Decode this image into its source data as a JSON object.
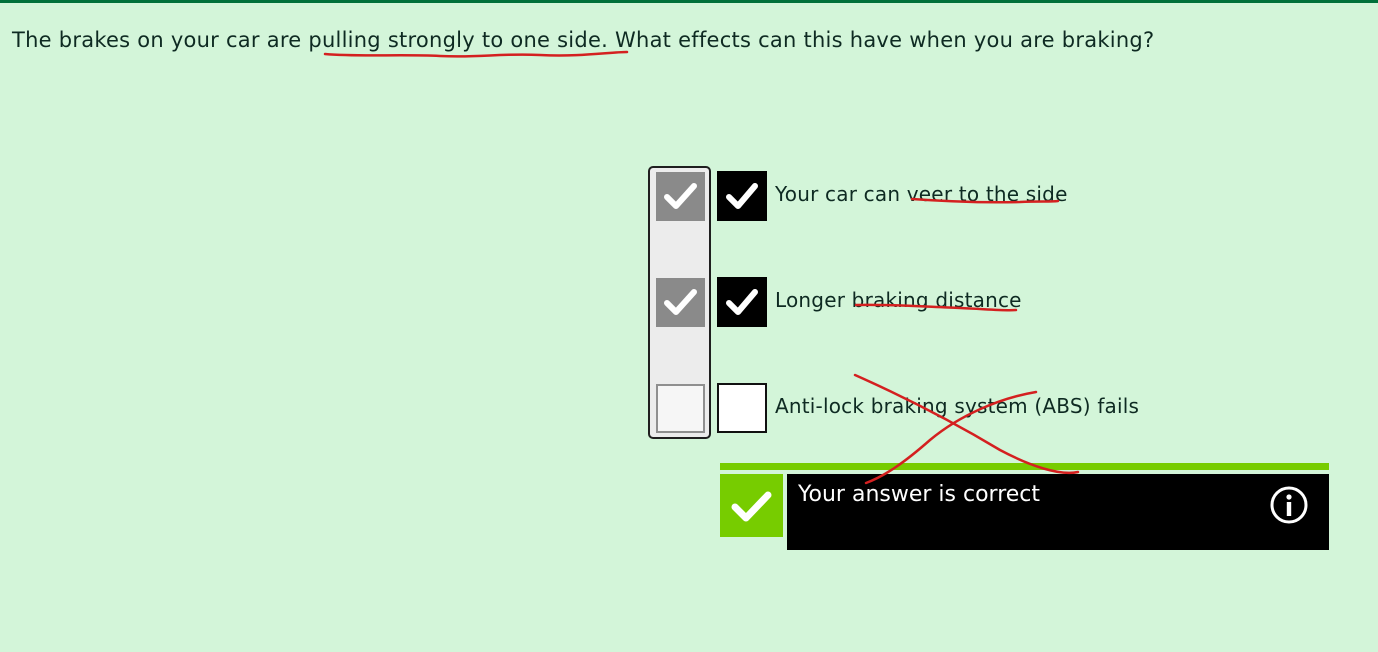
{
  "question": {
    "before": "The brakes on your car are ",
    "highlight": "pulling strongly to one side",
    "after": ". What effects can this have when you are braking?"
  },
  "options": [
    {
      "label": "Your car can veer to the side",
      "answer_checked": true,
      "reference_checked": true
    },
    {
      "label": "Longer braking distance",
      "answer_checked": true,
      "reference_checked": true
    },
    {
      "label": "Anti-lock braking system (ABS) fails",
      "answer_checked": false,
      "reference_checked": false
    }
  ],
  "result": {
    "text": "Your answer is correct",
    "icon": "info-icon",
    "status_icon": "check-icon"
  },
  "colors": {
    "background": "#d3f5d9",
    "accent_green": "#77cc00",
    "top_line": "#00703a",
    "annotation_ink": "#d42020",
    "reference_check": "#8a8a8a"
  }
}
